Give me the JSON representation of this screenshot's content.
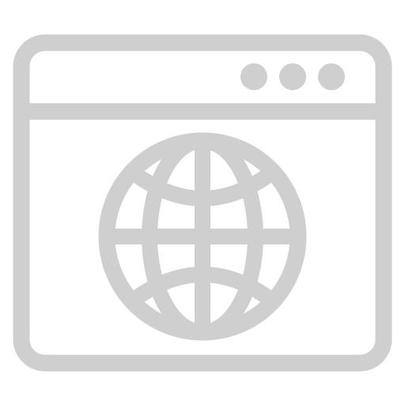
{
  "icon": {
    "name": "web-browser-globe-icon",
    "color": "#cfcfcf",
    "background": "#ffffff",
    "window_control_dots": 3
  }
}
